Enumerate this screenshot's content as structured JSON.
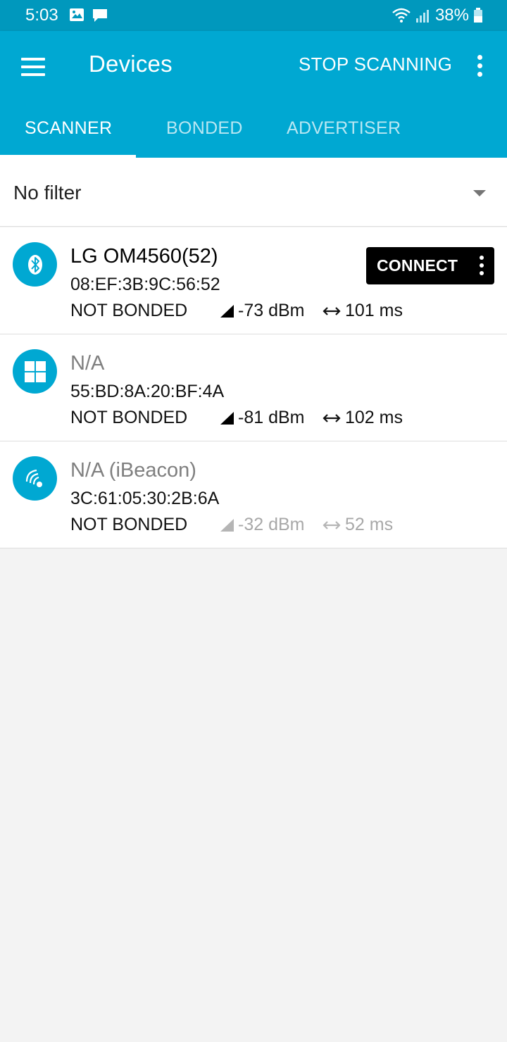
{
  "status_bar": {
    "time": "5:03",
    "battery": "38%"
  },
  "app_bar": {
    "title": "Devices",
    "action": "STOP SCANNING"
  },
  "tabs": [
    {
      "label": "SCANNER",
      "active": true
    },
    {
      "label": "BONDED",
      "active": false
    },
    {
      "label": "ADVERTISER",
      "active": false
    }
  ],
  "filter": {
    "selected": "No filter"
  },
  "connect_label": "CONNECT",
  "devices": [
    {
      "name": "LG OM4560(52)",
      "address": "08:EF:3B:9C:56:52",
      "bond_state": "NOT BONDED",
      "rssi": "-73 dBm",
      "interval": "101 ms",
      "icon": "bluetooth-icon"
    },
    {
      "name": "N/A",
      "address": "55:BD:8A:20:BF:4A",
      "bond_state": "NOT BONDED",
      "rssi": "-81 dBm",
      "interval": "102 ms",
      "icon": "windows-icon"
    },
    {
      "name": "N/A  (iBeacon)",
      "address": "3C:61:05:30:2B:6A",
      "bond_state": "NOT BONDED",
      "rssi": "-32 dBm",
      "interval": "52 ms",
      "icon": "beacon-icon"
    }
  ],
  "colors": {
    "primary": "#00a8d2",
    "status_bar": "#0098bd",
    "background": "#f3f3f3"
  }
}
